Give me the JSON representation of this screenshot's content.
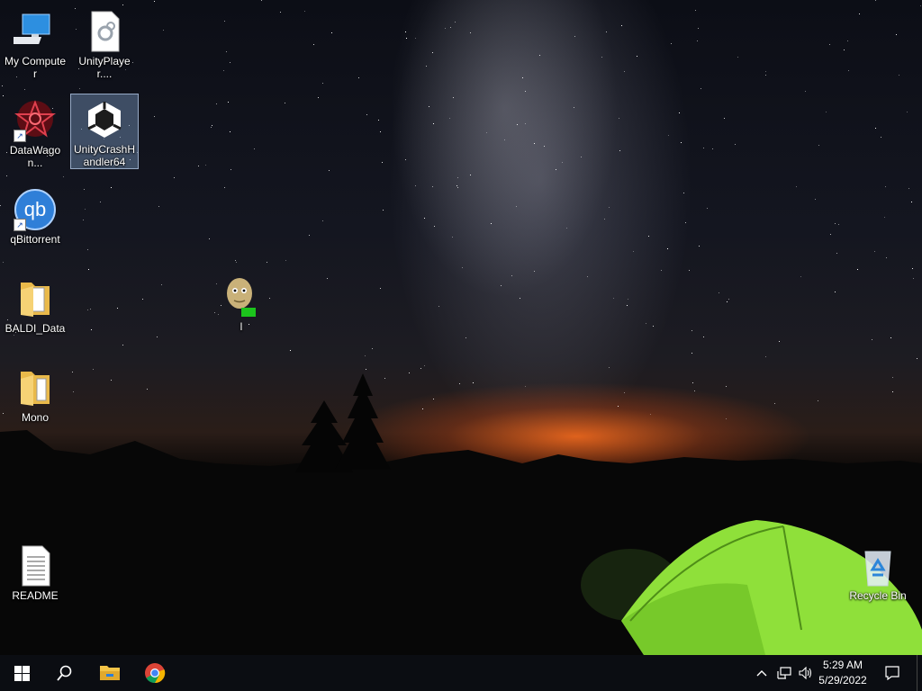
{
  "desktop": {
    "icons": [
      {
        "label": "My Computer",
        "icon": "computer-icon"
      },
      {
        "label": "UnityPlayer....",
        "icon": "dll-file-icon"
      },
      {
        "label": "DataWagon...",
        "icon": "datawagon-icon"
      },
      {
        "label": "UnityCrashHandler64",
        "icon": "unity-icon",
        "selected": true
      },
      {
        "label": "qBittorrent",
        "icon": "qbittorrent-icon"
      },
      {
        "label": "l",
        "icon": "baldi-icon"
      },
      {
        "label": "BALDI_Data",
        "icon": "folder-icon"
      },
      {
        "label": "Mono",
        "icon": "folder-icon"
      },
      {
        "label": "README",
        "icon": "text-file-icon"
      },
      {
        "label": "Recycle Bin",
        "icon": "recycle-bin-icon"
      }
    ]
  },
  "taskbar": {
    "start": "windows-start-icon",
    "search": "search-icon",
    "pinned": [
      "file-explorer-icon",
      "chrome-icon"
    ],
    "tray": {
      "chevron": "show-hidden-icons-chevron",
      "network": "network-icon",
      "volume": "volume-icon",
      "time": "5:29 AM",
      "date": "5/29/2022",
      "notifications": "action-center-icon"
    }
  },
  "colors": {
    "taskbar": "#0b0d12",
    "selection": "#7896be",
    "tent": "#8fe03a"
  }
}
